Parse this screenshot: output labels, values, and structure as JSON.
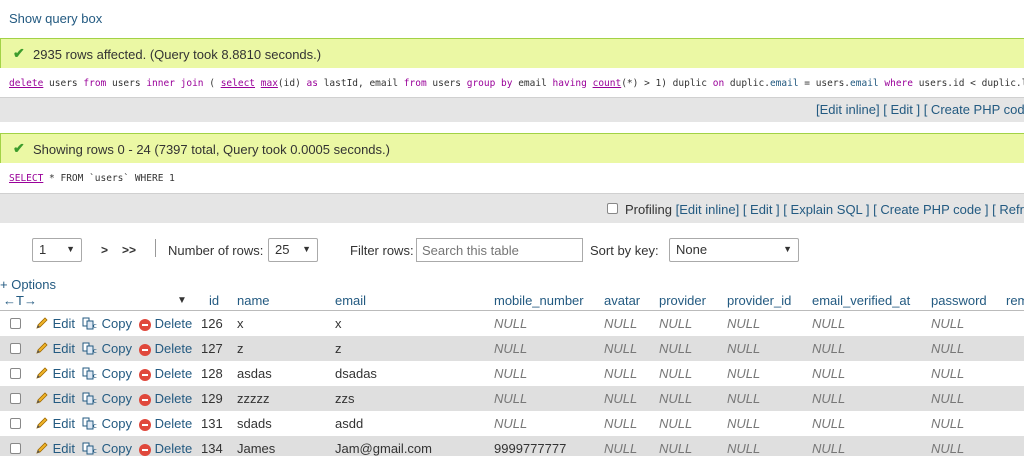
{
  "show_query_box": "Show query box",
  "msg1": {
    "text": "2935 rows affected. (Query took 8.8810 seconds.)",
    "sql": {
      "t1": "delete",
      "t2": " users ",
      "t3": "from",
      "t4": " users ",
      "t5": "inner join",
      "t6": " ( ",
      "t7": "select",
      "t8": " ",
      "t9": "max",
      "t10": "(id) ",
      "t11": "as",
      "t12": " lastId, email ",
      "t13": "from",
      "t14": " users ",
      "t15": "group by",
      "t16": " email ",
      "t17": "having",
      "t18": " ",
      "t19": "count",
      "t20": "(*) > 1) duplic ",
      "t21": "on",
      "t22": " duplic.",
      "t23": "email",
      "t24": " = users.",
      "t25": "email",
      "t26": " ",
      "t27": "where",
      "t28": " users.id < duplic.lastId"
    },
    "links": {
      "edit_inline": "[Edit inline]",
      "edit": "[ Edit ]",
      "create_php": "[ Create PHP code ]"
    }
  },
  "msg2": {
    "text": "Showing rows 0 - 24 (7397 total, Query took 0.0005 seconds.)",
    "sql": {
      "select": "SELECT",
      "rest": " * FROM `users` WHERE 1"
    },
    "profiling": "Profiling",
    "links": {
      "edit_inline": "[Edit inline]",
      "edit": "[ Edit ]",
      "explain": "[ Explain SQL ]",
      "create_php": "[ Create PHP code ]",
      "refresh": "[ Refresh"
    }
  },
  "nav": {
    "page": "1",
    "next": ">",
    "last": ">>",
    "num_rows_label": "Number of rows:",
    "num_rows": "25",
    "filter_label": "Filter rows:",
    "filter_placeholder": "Search this table",
    "sort_label": "Sort by key:",
    "sort_value": "None"
  },
  "options": "+ Options",
  "columns": [
    "id",
    "name",
    "email",
    "mobile_number",
    "avatar",
    "provider",
    "provider_id",
    "email_verified_at",
    "password",
    "rem"
  ],
  "actions": {
    "edit": "Edit",
    "copy": "Copy",
    "delete": "Delete"
  },
  "rows": [
    [
      "126",
      "x",
      "x",
      "NULL",
      "NULL",
      "NULL",
      "NULL",
      "NULL",
      "NULL"
    ],
    [
      "127",
      "z",
      "z",
      "NULL",
      "NULL",
      "NULL",
      "NULL",
      "NULL",
      "NULL"
    ],
    [
      "128",
      "asdas",
      "dsadas",
      "NULL",
      "NULL",
      "NULL",
      "NULL",
      "NULL",
      "NULL"
    ],
    [
      "129",
      "zzzzz",
      "zzs",
      "NULL",
      "NULL",
      "NULL",
      "NULL",
      "NULL",
      "NULL"
    ],
    [
      "131",
      "sdads",
      "asdd",
      "NULL",
      "NULL",
      "NULL",
      "NULL",
      "NULL",
      "NULL"
    ],
    [
      "134",
      "James",
      "Jam@gmail.com",
      "9999777777",
      "NULL",
      "NULL",
      "NULL",
      "NULL",
      "NULL"
    ]
  ]
}
